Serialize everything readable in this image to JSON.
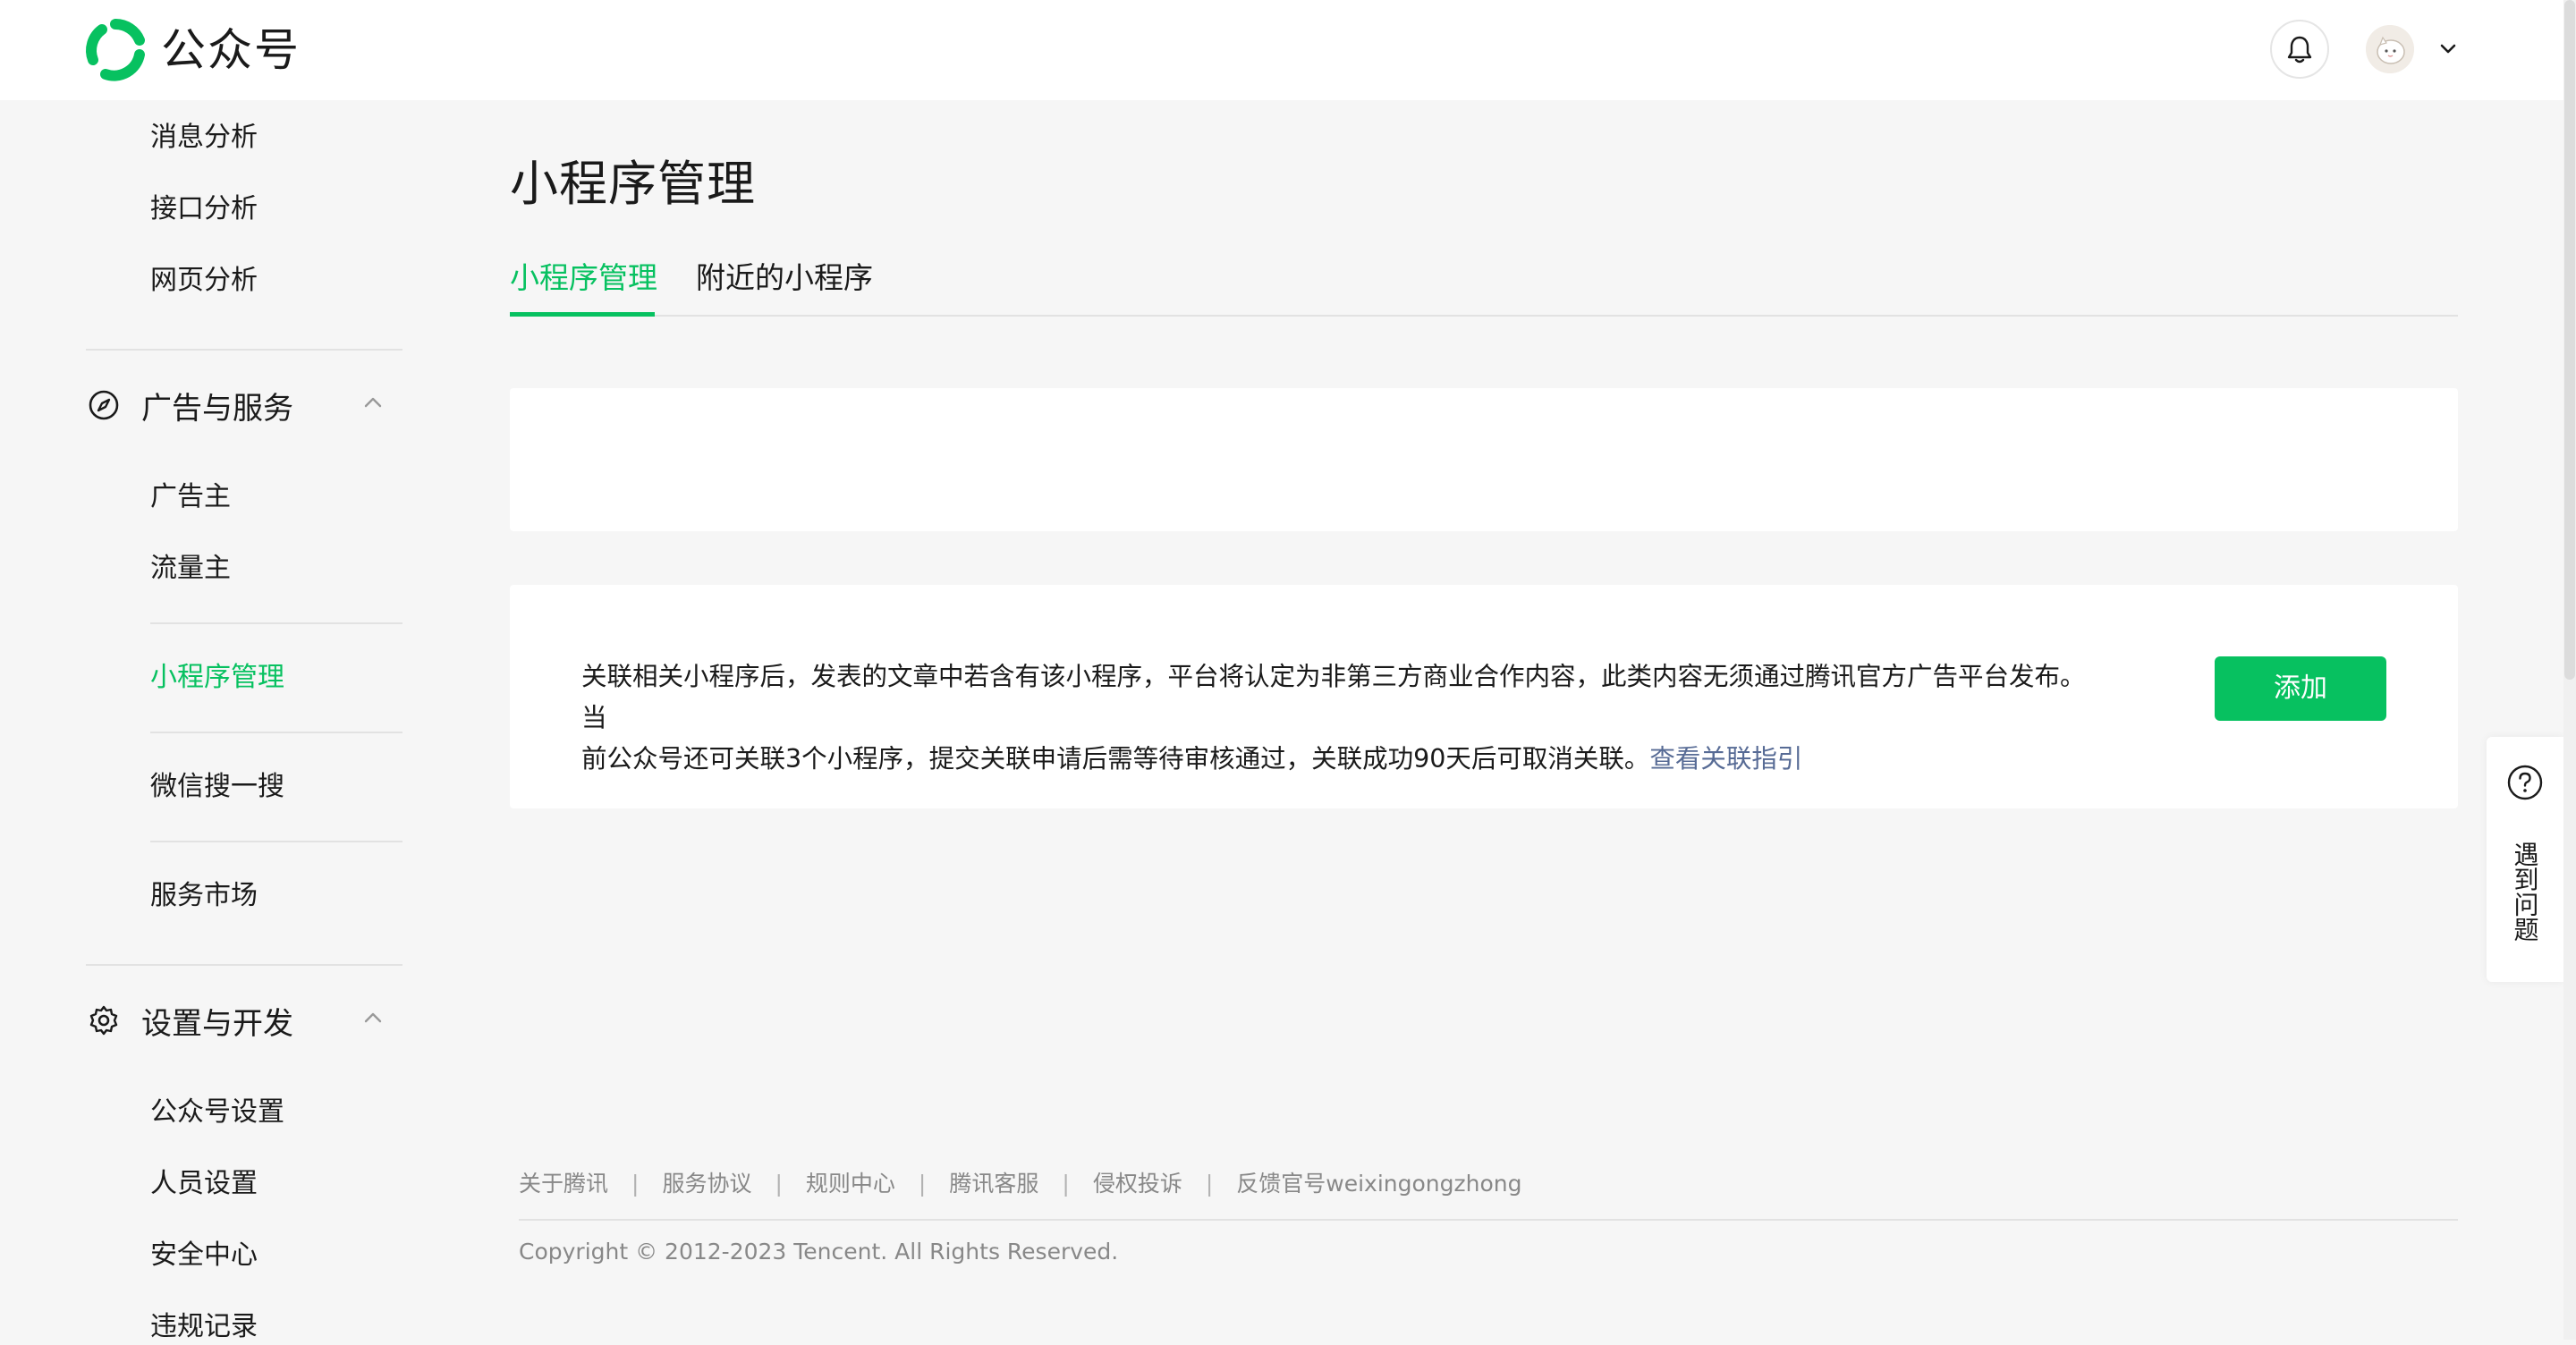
{
  "header": {
    "brand": "公众号",
    "icons": {
      "logo": "wechat-official-accounts-logo",
      "bell": "bell-icon",
      "caret": "chevron-down-icon"
    }
  },
  "sidebar": {
    "items_top": [
      "消息分析",
      "接口分析",
      "网页分析"
    ],
    "group_ads": {
      "title": "广告与服务",
      "icon": "compass-icon",
      "items": [
        "广告主",
        "流量主",
        "小程序管理",
        "微信搜一搜",
        "服务市场"
      ],
      "active": "小程序管理"
    },
    "group_settings": {
      "title": "设置与开发",
      "icon": "gear-icon",
      "items": [
        "公众号设置",
        "人员设置",
        "安全中心",
        "违规记录"
      ]
    }
  },
  "main": {
    "title": "小程序管理",
    "tabs": [
      {
        "label": "小程序管理",
        "active": true
      },
      {
        "label": "附近的小程序",
        "active": false
      }
    ],
    "notice": {
      "line1": "关联相关小程序后，发表的文章中若含有该小程序，平台将认定为非第三方商业合作内容，此类内容无须通过腾讯官方广告平台发布。当",
      "line2": "前公众号还可关联3个小程序，提交关联申请后需等待审核通过，关联成功90天后可取消关联。",
      "link": "查看关联指引"
    },
    "add_button": "添加"
  },
  "footer": {
    "links": [
      "关于腾讯",
      "服务协议",
      "规则中心",
      "腾讯客服",
      "侵权投诉",
      "反馈官号weixingongzhong"
    ],
    "separator": "|",
    "copyright": "Copyright © 2012-2023 Tencent. All Rights Reserved."
  },
  "help": {
    "label": "遇到问题",
    "icon": "question-circle-icon"
  },
  "colors": {
    "accent": "#07c160",
    "link": "#576b95",
    "background": "#f6f6f6"
  }
}
